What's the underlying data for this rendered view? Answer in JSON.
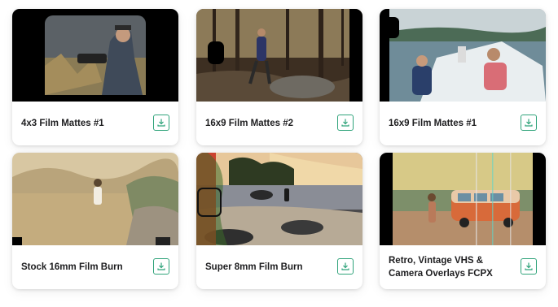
{
  "cards": [
    {
      "title": "4x3 Film Mattes #1",
      "thumbnail": "man-with-camera-in-field",
      "action_icon": "download-icon"
    },
    {
      "title": "16x9 Film Mattes #2",
      "thumbnail": "hiker-in-autumn-forest",
      "action_icon": "download-icon"
    },
    {
      "title": "16x9 Film Mattes #1",
      "thumbnail": "people-on-boat",
      "action_icon": "download-icon"
    },
    {
      "title": "Stock 16mm Film Burn",
      "thumbnail": "sepia-field-with-figure",
      "action_icon": "download-icon"
    },
    {
      "title": "Super 8mm Film Burn",
      "thumbnail": "rocky-beach-at-sunset",
      "action_icon": "download-icon"
    },
    {
      "title": "Retro, Vintage VHS & Camera Overlays FCPX",
      "thumbnail": "orange-van-vhs",
      "action_icon": "download-icon"
    }
  ],
  "colors": {
    "accent": "#2fa37a",
    "text": "#1d1d1f"
  }
}
